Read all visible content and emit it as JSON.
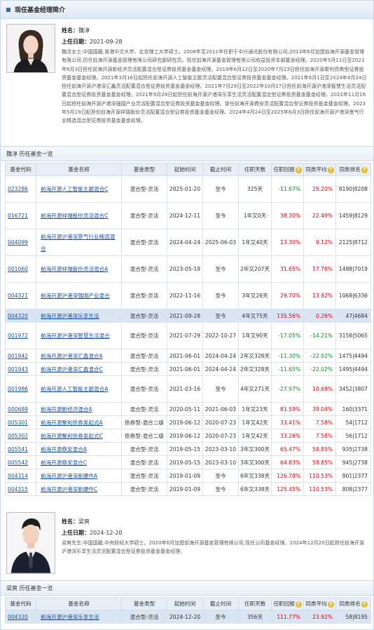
{
  "header": {
    "title": "现任基金经理简介"
  },
  "managers": [
    {
      "name_label": "姓名：",
      "name": "魏淳",
      "date_label": "上任日期：",
      "date": "2021-09-28",
      "bio": "魏淳女士:中国国籍,香港中文大学、北京理工大学硕士。2008年至2011年任职于中兴通讯股份有限公司;2013年6月加盟前海开源基金管理有限公司,历任前海开源基金管理有限公司研究部研究员。现任前海开源基金管理有限公司权益投资本部基金经理。2020年5月11日至2021年6月3日担任前海开源新经济灵活配置混合型证券投资基金基金经理。2019年6月12日至2020年7月23日担任前海开源聚利债券型证券投资基金基金经理。2021年3月16日起担任前海开源人工智能主题灵活配置混合型证券投资基金基金经理。2021年6月1日至2024年4月24日担任前海开源沪港深汇鑫灵活配置混合型证券投资基金基金经理。2021年7月29日至2022年10月27日担任前海开源沪港深智慧生活灵活配置混合型证券投资基金基金经理。2021年9月28日起担任前海开源沪港深乐享生活灵活配置混合型证券投资基金基金经理。2022年11月16日起担任前海开源沪港深强国产业灵活配置混合型证券投资基金基金经理。曾任前海开源鼎安灵活配置混合型证券投资基金基金经理。2023年5月19日起担任前海开源祥瑞股份灵活配置混合型证券投资基金基金经理。2024年4月24日至2025年6月3日担任前海开源沪港深景气行业精选混合型证券投资基金基金经理。"
    },
    {
      "name_label": "姓名：",
      "name": "梁爽",
      "date_label": "上任日期：",
      "date": "2024-12-20",
      "bio": "梁爽先生:中国国籍,中央财经大学硕士。2020年6月加盟前海开源基金管理有限公司,现任公司基金经理。2024年12月20日起担任前海开源沪港深乐享生活灵活配置混合型证券投资基金基金经理。"
    }
  ],
  "columns": [
    "基金代码",
    "基金名称",
    "基金类型",
    "起始时间",
    "截止时间",
    "任职天数",
    "任职回报",
    "同类平均",
    "同类排名"
  ],
  "history": [
    {
      "title": "魏淳 历任基金一览",
      "rows": [
        {
          "code": "023286",
          "name": "前海开源人工智能主题混合C",
          "type": "混合型-灵活",
          "start": "2025-01-20",
          "end": "至今",
          "days": "325天",
          "ret": "-11.67%",
          "avg": "25.20%",
          "rank": "8190|8208",
          "h": 38
        },
        {
          "code": "016721",
          "name": "前海开源祥瑞股份灵活混合C",
          "type": "混合型-灵活",
          "start": "2024-12-11",
          "end": "至今",
          "days": "1年又0天",
          "ret": "38.30%",
          "avg": "22.49%",
          "rank": "1459|8129",
          "h": 38
        },
        {
          "code": "004099",
          "name": "前海开源沪港深景气行业精选混合",
          "type": "混合型-灵活",
          "start": "2024-04-24",
          "end": "2025-06-03",
          "days": "1年又40天",
          "ret": "13.30%",
          "avg": "9.12%",
          "rank": "2125|8712",
          "h": 38
        },
        {
          "code": "001060",
          "name": "前海开源祥瑞股份灵活混合A",
          "type": "混合型-灵活",
          "start": "2023-05-19",
          "end": "至今",
          "days": "2年又207天",
          "ret": "31.65%",
          "avg": "17.76%",
          "rank": "1488|7019",
          "h": 38
        },
        {
          "code": "004321",
          "name": "前海开源沪港深强国产业混合",
          "type": "混合型-灵活",
          "start": "2022-11-16",
          "end": "至今",
          "days": "3年又26天",
          "ret": "29.70%",
          "avg": "13.92%",
          "rank": "1068|6336",
          "h": 38
        },
        {
          "code": "004320",
          "name": "前海开源沪港深乐享生活",
          "type": "混合型-灵活",
          "start": "2021-09-28",
          "end": "至今",
          "days": "4年又75天",
          "ret": "135.56%",
          "avg": "0.26%",
          "rank": "47|4684",
          "h": 19,
          "hl": true
        },
        {
          "code": "001972",
          "name": "前海开源沪港深智慧生活混合",
          "type": "混合型-灵活",
          "start": "2021-07-29",
          "end": "2022-10-27",
          "days": "1年又90天",
          "ret": "-17.05%",
          "avg": "-14.21%",
          "rank": "3158|5065",
          "h": 38
        },
        {
          "code": "001942",
          "name": "前海开源沪港深汇鑫混合A",
          "type": "混合型-灵活",
          "start": "2021-06-01",
          "end": "2024-04-24",
          "days": "2年又328天",
          "ret": "-11.30%",
          "avg": "-22.02%",
          "rank": "1475|4494",
          "h": 19
        },
        {
          "code": "001943",
          "name": "前海开源沪港深汇鑫混合C",
          "type": "混合型-灵活",
          "start": "2021-06-01",
          "end": "2024-04-24",
          "days": "2年又328天",
          "ret": "-11.65%",
          "avg": "-22.02%",
          "rank": "1495|4494",
          "h": 19
        },
        {
          "code": "001986",
          "name": "前海开源人工智能主题混合A",
          "type": "混合型-灵活",
          "start": "2021-03-16",
          "end": "至今",
          "days": "4年又271天",
          "ret": "-27.97%",
          "avg": "10.69%",
          "rank": "3452|3807",
          "h": 38
        },
        {
          "code": "000689",
          "name": "前海开源新经济混合A",
          "type": "混合型-灵活",
          "start": "2020-05-11",
          "end": "2021-06-03",
          "days": "1年又23天",
          "ret": "81.59%",
          "avg": "39.04%",
          "rank": "160|3371",
          "h": 19
        },
        {
          "code": "005301",
          "name": "前海开源聚利债券发起式A",
          "type": "债券型-混合二级",
          "start": "2019-06-12",
          "end": "2020-07-23",
          "days": "1年又42天",
          "ret": "33.41%",
          "avg": "7.58%",
          "rank": "54|1712",
          "h": 19
        },
        {
          "code": "005302",
          "name": "前海开源聚利债券发起式C",
          "type": "债券型-混合二级",
          "start": "2019-06-12",
          "end": "2020-07-23",
          "days": "1年又42天",
          "ret": "33.26%",
          "avg": "7.58%",
          "rank": "56|1712",
          "h": 19
        },
        {
          "code": "005541",
          "name": "前海开源鼎安混合A",
          "type": "混合型-灵活",
          "start": "2019-05-15",
          "end": "2023-03-10",
          "days": "3年又300天",
          "ret": "65.47%",
          "avg": "58.85%",
          "rank": "935|2738",
          "h": 19
        },
        {
          "code": "005542",
          "name": "前海开源鼎安混合C",
          "type": "混合型-灵活",
          "start": "2019-05-15",
          "end": "2023-03-10",
          "days": "3年又300天",
          "ret": "64.83%",
          "avg": "58.85%",
          "rank": "945|2738",
          "h": 19
        },
        {
          "code": "004314",
          "name": "前海开源沪港深新硬件A",
          "type": "混合型-灵活",
          "start": "2019-01-09",
          "end": "至今",
          "days": "6年又338天",
          "ret": "126.78%",
          "avg": "110.53%",
          "rank": "801|2377",
          "h": 19
        },
        {
          "code": "004315",
          "name": "前海开源沪港深新硬件C",
          "type": "混合型-灵活",
          "start": "2019-01-09",
          "end": "至今",
          "days": "6年又338天",
          "ret": "125.45%",
          "avg": "110.53%",
          "rank": "808|2377",
          "h": 19
        }
      ]
    },
    {
      "title": "梁爽 历任基金一览",
      "rows": [
        {
          "code": "004320",
          "name": "前海开源沪港深乐享生活",
          "type": "混合型-灵活",
          "start": "2024-12-20",
          "end": "至今",
          "days": "356天",
          "ret": "111.77%",
          "avg": "23.92%",
          "rank": "58|8195",
          "h": 19,
          "hl": true
        }
      ]
    }
  ],
  "icons": {
    "header_mark": "square-bullet-icon",
    "help": "question-icon"
  },
  "colors": {
    "positive": "#d6000f",
    "negative": "#0a8a28",
    "link": "#1a4f9c",
    "highlight": "#d9e5f3"
  }
}
